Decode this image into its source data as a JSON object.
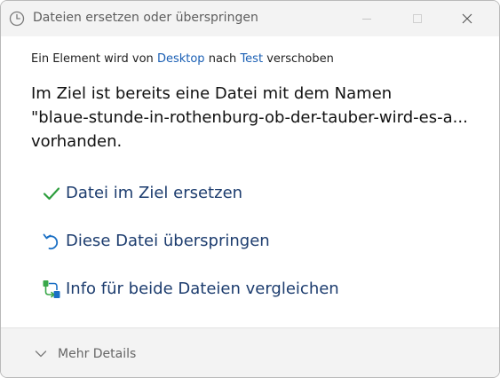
{
  "window": {
    "title": "Dateien ersetzen oder überspringen"
  },
  "message": {
    "prefix": "Ein Element wird von",
    "source": "Desktop",
    "middle": "nach",
    "target": "Test",
    "suffix": "verschoben",
    "heading_line1": "Im Ziel ist bereits eine Datei mit dem Namen",
    "heading_line2": "\"blaue-stunde-in-rothenburg-ob-der-tauber-wird-es-a...",
    "heading_line3": "vorhanden."
  },
  "options": [
    {
      "label": "Datei im Ziel ersetzen",
      "icon": "checkmark-icon"
    },
    {
      "label": "Diese Datei überspringen",
      "icon": "undo-arrow-icon"
    },
    {
      "label": "Info für beide Dateien vergleichen",
      "icon": "compare-files-icon"
    }
  ],
  "footer": {
    "more_details": "Mehr Details"
  },
  "colors": {
    "accent_link": "#1a5fb4",
    "option_text": "#1c3c6e",
    "check_green": "#2e9e3e"
  }
}
